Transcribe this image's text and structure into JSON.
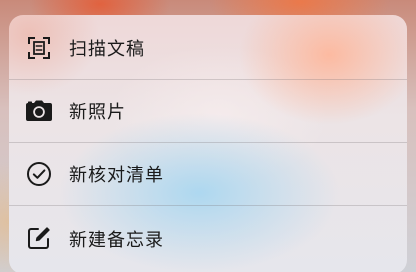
{
  "menu": {
    "items": [
      {
        "label": "扫描文稿",
        "icon": "scan-document-icon"
      },
      {
        "label": "新照片",
        "icon": "camera-icon"
      },
      {
        "label": "新核对清单",
        "icon": "checkmark-circle-icon"
      },
      {
        "label": "新建备忘录",
        "icon": "compose-icon"
      }
    ]
  },
  "colors": {
    "text": "#1a1a1a",
    "icon": "#1a1a1a"
  }
}
